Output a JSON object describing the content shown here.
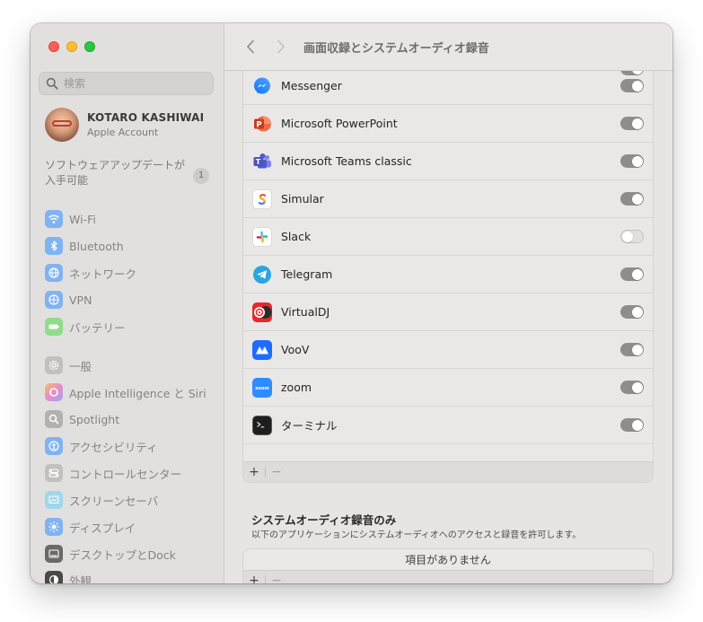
{
  "window": {
    "title": "画面収録とシステムオーディオ録音"
  },
  "sidebar": {
    "search_placeholder": "検索",
    "account": {
      "name": "KOTARO KASHIWAI",
      "subtitle": "Apple Account"
    },
    "update": {
      "text": "ソフトウェアアップデートが入手可能",
      "count": "1"
    },
    "items": [
      {
        "label": "Wi-Fi",
        "icon": "wifi-icon",
        "color": "#3d8cf0"
      },
      {
        "label": "Bluetooth",
        "icon": "bluetooth-icon",
        "color": "#3d8cf0"
      },
      {
        "label": "ネットワーク",
        "icon": "globe-icon",
        "color": "#3d8cf0"
      },
      {
        "label": "VPN",
        "icon": "vpn-icon",
        "color": "#3d8cf0"
      },
      {
        "label": "バッテリー",
        "icon": "battery-icon",
        "color": "#5cc95a"
      },
      {
        "label": "一般",
        "icon": "gear-icon",
        "color": "#9a9896"
      },
      {
        "label": "Apple Intelligence と Siri",
        "icon": "siri-icon",
        "color": "#e8a0d0"
      },
      {
        "label": "Spotlight",
        "icon": "spotlight-icon",
        "color": "#8f8d8b"
      },
      {
        "label": "アクセシビリティ",
        "icon": "accessibility-icon",
        "color": "#3d8cf0"
      },
      {
        "label": "コントロールセンター",
        "icon": "control-center-icon",
        "color": "#9a9896"
      },
      {
        "label": "スクリーンセーバ",
        "icon": "screensaver-icon",
        "color": "#5ec4e0"
      },
      {
        "label": "ディスプレイ",
        "icon": "display-icon",
        "color": "#3d8cf0"
      },
      {
        "label": "デスクトップとDock",
        "icon": "dock-icon",
        "color": "#444444"
      },
      {
        "label": "外観",
        "icon": "appearance-icon",
        "color": "#333333"
      }
    ]
  },
  "apps": [
    {
      "name": "",
      "icon": "green-app-icon",
      "enabled": true
    },
    {
      "name": "Messenger",
      "icon": "messenger-icon",
      "enabled": true
    },
    {
      "name": "Microsoft PowerPoint",
      "icon": "powerpoint-icon",
      "enabled": true
    },
    {
      "name": "Microsoft Teams classic",
      "icon": "teams-icon",
      "enabled": true
    },
    {
      "name": "Simular",
      "icon": "simular-icon",
      "enabled": true
    },
    {
      "name": "Slack",
      "icon": "slack-icon",
      "enabled": false
    },
    {
      "name": "Telegram",
      "icon": "telegram-icon",
      "enabled": true
    },
    {
      "name": "VirtualDJ",
      "icon": "virtualdj-icon",
      "enabled": true
    },
    {
      "name": "VooV",
      "icon": "voov-icon",
      "enabled": true
    },
    {
      "name": "zoom",
      "icon": "zoom-icon",
      "enabled": true
    },
    {
      "name": "ターミナル",
      "icon": "terminal-icon",
      "enabled": true
    }
  ],
  "list_footer": {
    "add": "+",
    "remove": "−"
  },
  "audio_section": {
    "title": "システムオーディオ録音のみ",
    "description": "以下のアプリケーションにシステムオーディオへのアクセスと録音を許可します。",
    "empty_text": "項目がありません"
  },
  "colors": {
    "toggle_on": "#8f8d8b",
    "toggle_off": "#e2e0de",
    "close": "#ff5f57",
    "minimize": "#febc2e",
    "maximize": "#28c840"
  }
}
